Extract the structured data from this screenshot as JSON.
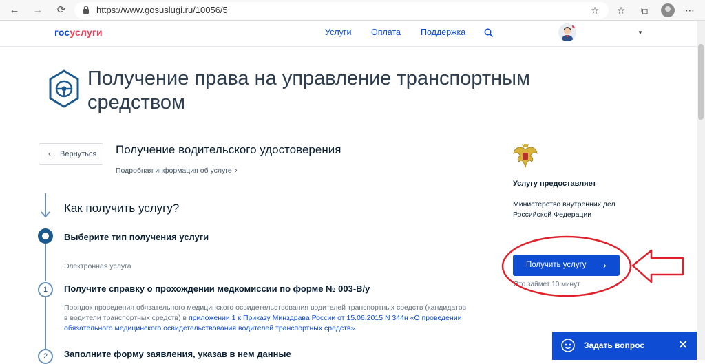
{
  "browser": {
    "url": "https://www.gosuslugi.ru/10056/5",
    "icons": [
      "back-arrow-icon",
      "forward-arrow-icon",
      "refresh-icon",
      "lock-icon",
      "star-icon",
      "favorites-icon",
      "collections-icon",
      "profile-icon",
      "more-icon"
    ]
  },
  "header": {
    "logo_part1": "гос",
    "logo_part2": "услуги",
    "nav": [
      "Услуги",
      "Оплата",
      "Поддержка"
    ],
    "colors": {
      "brand_blue": "#0d4cd3",
      "brand_red": "#ee3f58"
    }
  },
  "page": {
    "title": "Получение права на управление транспортным средством",
    "back_label": "Вернуться",
    "subtitle": "Получение водительского удостоверения",
    "details_link": "Подробная информация об услуге"
  },
  "steps": {
    "how_title": "Как получить услугу?",
    "step1_title": "Выберите тип получения услуги",
    "step1_sub": "Электронная услуга",
    "step2_num": "1",
    "step2_title": "Получите справку о прохождении медкомиссии по форме № 003-В/у",
    "step2_desc_1": "Порядок проведения обязательного медицинского освидетельствования водителей транспортных средств (кандидатов в водители транспортных средств) в ",
    "step2_desc_link": "приложении 1 к Приказу Минздрава России от 15.06.2015 N 344н «О проведении обязательного медицинского освидетельствования водителей транспортных средств»",
    "step2_desc_2": ".",
    "step3_num": "2",
    "step3_title": "Заполните форму заявления, указав в нем данные"
  },
  "provider": {
    "label": "Услугу предоставляет",
    "name": "Министерство внутренних дел Российской Федерации"
  },
  "cta": {
    "button_label": "Получить услугу",
    "duration": "Это займет 10 минут",
    "annotation_color": "#e0202a"
  },
  "chat": {
    "label": "Задать вопрос"
  }
}
